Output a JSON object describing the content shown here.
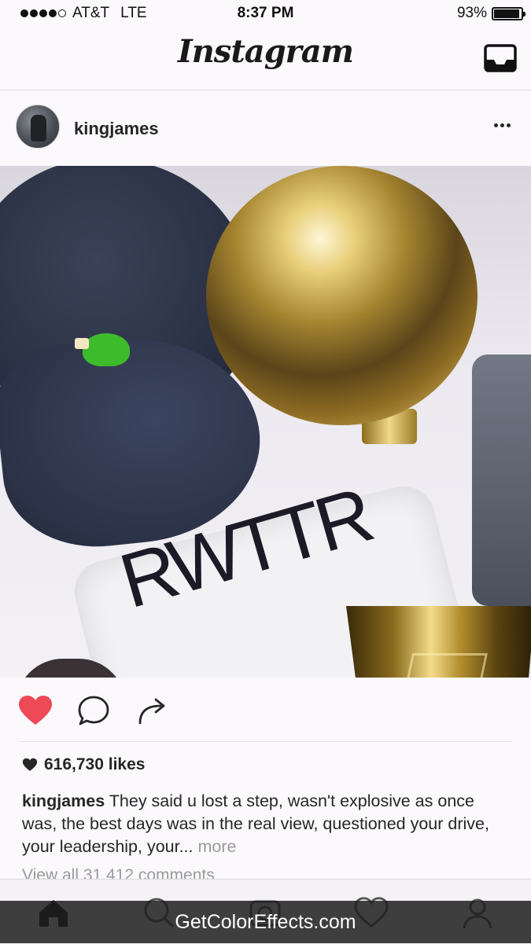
{
  "status_bar": {
    "carrier": "AT&T",
    "network": "LTE",
    "time": "8:37 PM",
    "battery": "93%",
    "battery_level": 0.93,
    "signal_bars_filled": 4
  },
  "header": {
    "logo": "Instagram",
    "inbox_icon": "inbox-tray-icon"
  },
  "post": {
    "username": "kingjames",
    "more_icon": "more-dots-icon",
    "photo_shirt_text": "RWTTR",
    "liked": true,
    "like_color": "#ed4956",
    "likes": "616,730 likes",
    "caption_username": "kingjames",
    "caption_text": "They said u lost a step, wasn't explosive as once was, the best days was in the real view, questioned your drive, your leadership, your...",
    "caption_more": "more",
    "view_comments": "View all 31,412 comments"
  },
  "tab_bar": {
    "items": [
      "home-icon",
      "search-icon",
      "camera-icon",
      "heart-icon",
      "profile-icon"
    ],
    "active": "home-icon"
  },
  "watermark": "GetColorEffects.com"
}
